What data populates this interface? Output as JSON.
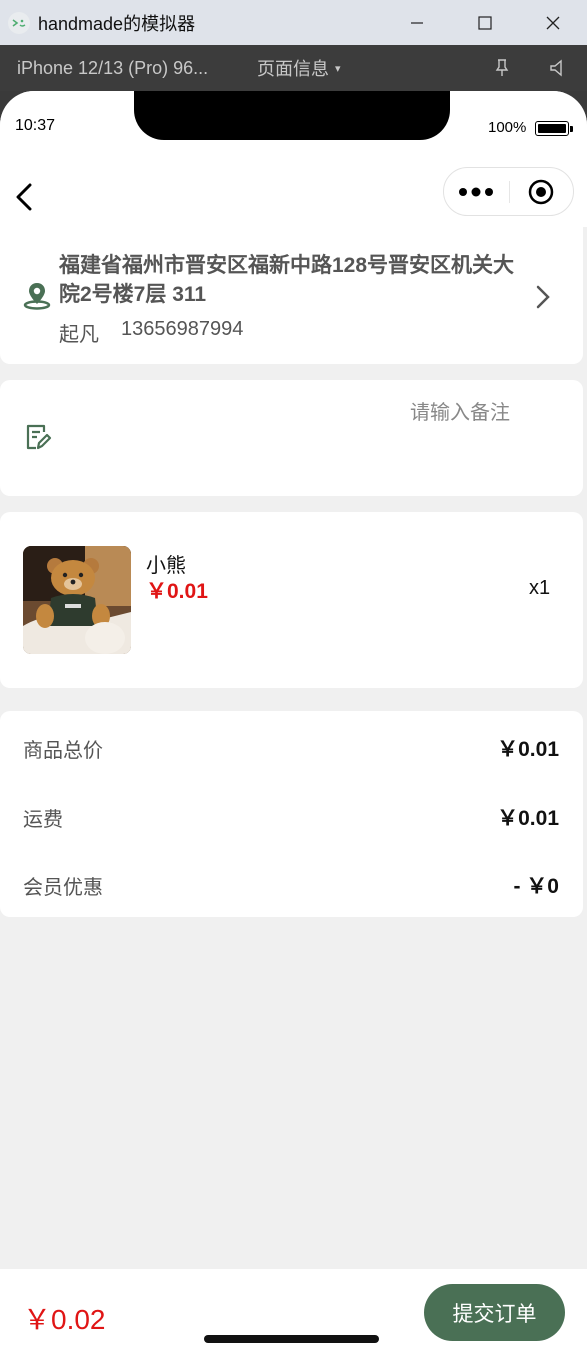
{
  "window": {
    "title": "handmade的模拟器",
    "minimize_icon": "minimize-icon",
    "maximize_icon": "maximize-icon",
    "close_icon": "close-icon"
  },
  "toolbar": {
    "device": "iPhone 12/13 (Pro) 96...",
    "page_info": "页面信息",
    "caret": "▾"
  },
  "status_bar": {
    "time": "10:37",
    "battery": "100%"
  },
  "address": {
    "text": "福建省福州市晋安区福新中路128号晋安区机关大院2号楼7层 311",
    "name": "起凡",
    "phone": "13656987994"
  },
  "note": {
    "placeholder": "请输入备注"
  },
  "goods": [
    {
      "name": "小熊",
      "price": "￥0.01",
      "qty": "x1"
    }
  ],
  "summary": [
    {
      "label": "商品总价",
      "value": "￥0.01"
    },
    {
      "label": "运费",
      "value": "￥0.01"
    },
    {
      "label": "会员优惠",
      "value": "- ￥0"
    }
  ],
  "bottom": {
    "total": "￥0.02",
    "submit_label": "提交订单"
  },
  "colors": {
    "accent_green": "#4a7055",
    "price_red": "#e01515"
  }
}
